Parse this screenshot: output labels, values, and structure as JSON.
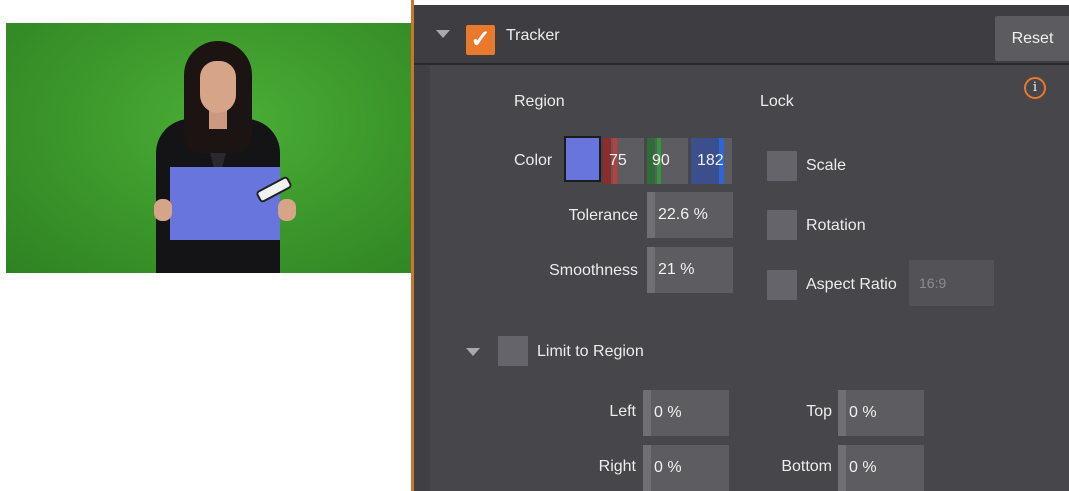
{
  "tracker": {
    "title": "Tracker",
    "enabled": true,
    "reset_label": "Reset",
    "info_label": "i"
  },
  "region": {
    "heading": "Region",
    "color_label": "Color",
    "color_swatch": "#6775dd",
    "red": "75",
    "green": "90",
    "blue": "182",
    "tolerance_label": "Tolerance",
    "tolerance_value": "22.6 %",
    "smoothness_label": "Smoothness",
    "smoothness_value": "21 %"
  },
  "lock": {
    "heading": "Lock",
    "scale_label": "Scale",
    "rotation_label": "Rotation",
    "aspect_label": "Aspect Ratio",
    "aspect_value": "16:9"
  },
  "limit": {
    "label": "Limit to Region",
    "left_label": "Left",
    "left_value": "0 %",
    "top_label": "Top",
    "top_value": "0 %",
    "right_label": "Right",
    "right_value": "0 %",
    "bottom_label": "Bottom",
    "bottom_value": "0 %"
  },
  "colors": {
    "accent": "#e9792d",
    "panel_bg": "#46464b",
    "field_bg": "#5c5c61",
    "chroma_green": "#3d9a2c"
  }
}
